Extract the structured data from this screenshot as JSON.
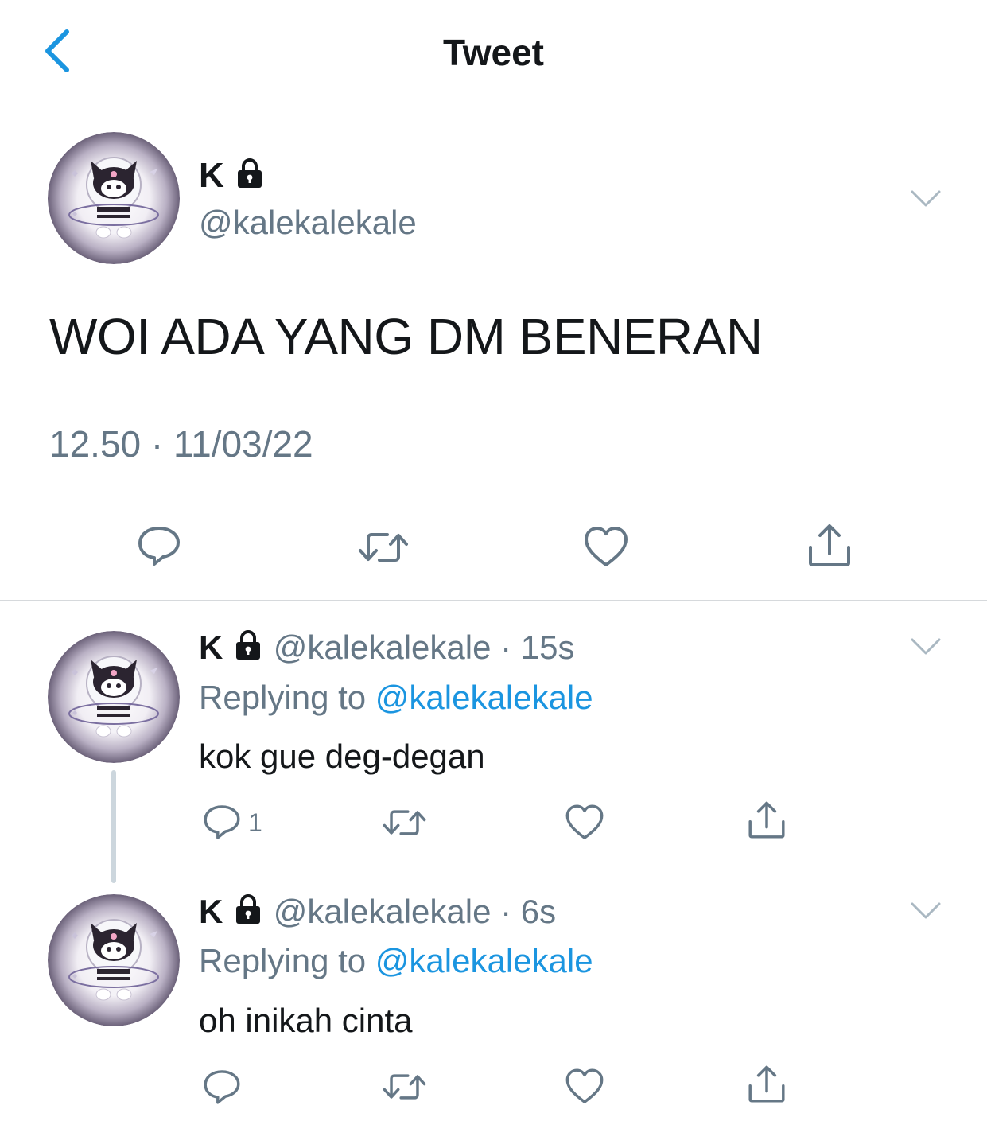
{
  "header": {
    "title": "Tweet",
    "back_icon": "chevron-left-icon"
  },
  "colors": {
    "accent": "#1b95e0",
    "secondary_text": "#657786",
    "divider": "#d6d9dc"
  },
  "main_tweet": {
    "name": "K",
    "handle": "@kalekalekale",
    "text": "WOI ADA YANG DM BENERAN",
    "timestamp": "12.50 · 11/03/22"
  },
  "replies": [
    {
      "name": "K",
      "handle": "@kalekalekale",
      "time": "· 15s",
      "replying_prefix": "Replying to ",
      "replying_handle": "@kalekalekale",
      "text": "kok gue deg-degan",
      "reply_count": "1"
    },
    {
      "name": "K",
      "handle": "@kalekalekale",
      "time": "· 6s",
      "replying_prefix": "Replying to ",
      "replying_handle": "@kalekalekale",
      "text": "oh inikah cinta",
      "reply_count": ""
    }
  ]
}
